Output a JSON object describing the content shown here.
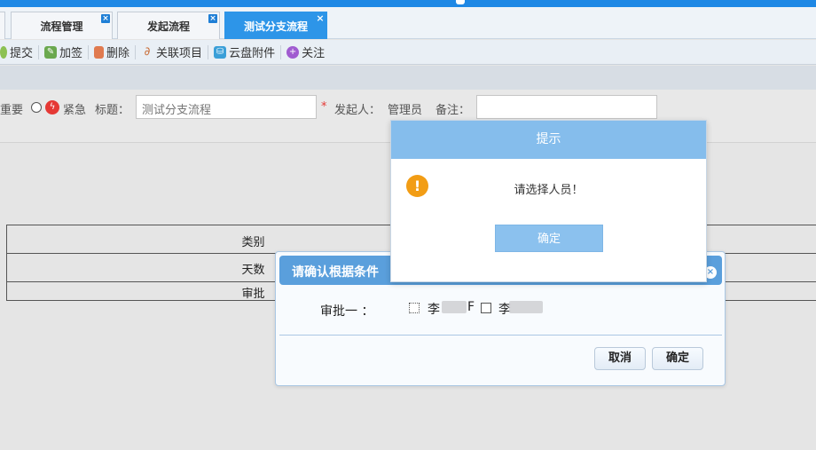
{
  "tabs": [
    {
      "label": "流程管理",
      "close": "×"
    },
    {
      "label": "发起流程",
      "close": "×"
    },
    {
      "label": "测试分支流程",
      "close": "×"
    }
  ],
  "toolbar": {
    "submit": "提交",
    "add_sign": "加签",
    "delete": "删除",
    "link_project": "关联项目",
    "cloud_attach": "云盘附件",
    "follow": "关注"
  },
  "form": {
    "important": "重要",
    "urgent": "紧急",
    "title_label": "标题：",
    "title_value": "测试分支流程",
    "required_mark": "*",
    "initiator_label": "发起人：",
    "initiator_value": "管理员",
    "remark_label": "备注："
  },
  "grid": {
    "row1": "类别",
    "row2": "天数",
    "row3": "审批"
  },
  "confirm_dialog": {
    "title": "请确认根据条件",
    "close": "×",
    "approver_label": "审批一 ：",
    "option1_name": "李",
    "option1_suffix": "F",
    "option2_name": "李",
    "cancel": "取消",
    "ok": "确定"
  },
  "alert_dialog": {
    "title": "提示",
    "icon": "!",
    "message": "请选择人员！",
    "ok": "确定"
  },
  "colors": {
    "accent": "#2d95e8",
    "dialog_header": "#85bdec",
    "warn": "#f29d15"
  }
}
